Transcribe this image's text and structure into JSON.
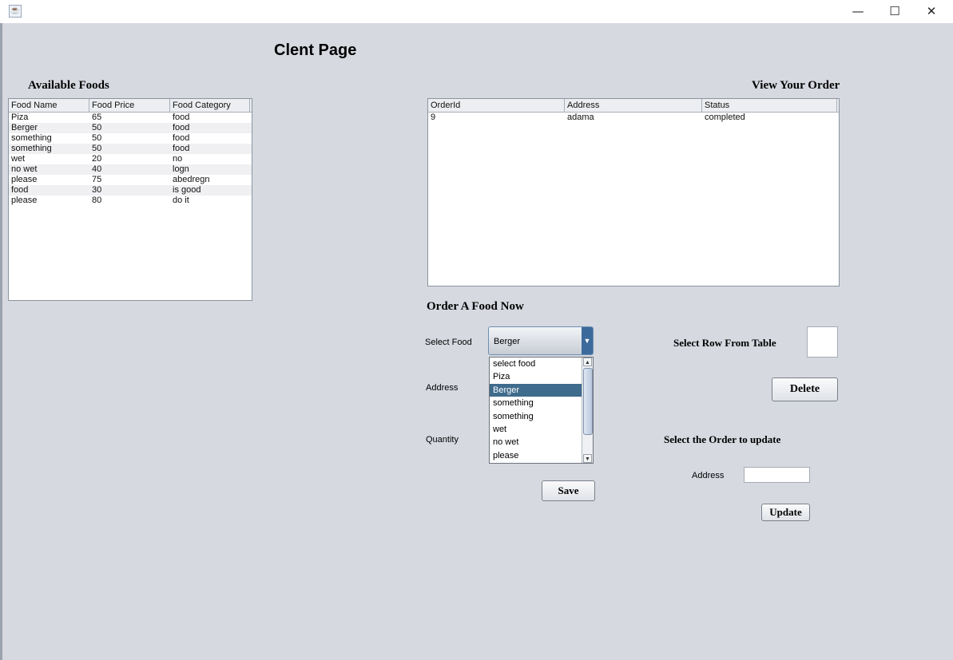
{
  "window": {
    "minimize": "—",
    "maximize": "☐",
    "close": "✕",
    "app_icon": "java-cup-icon"
  },
  "page_title": "Clent Page",
  "foods": {
    "heading": "Available Foods",
    "columns": [
      "Food Name",
      "Food Price",
      "Food Category"
    ],
    "rows": [
      [
        "Piza",
        "65",
        "food"
      ],
      [
        "Berger",
        "50",
        "food"
      ],
      [
        "something",
        "50",
        "food"
      ],
      [
        "something",
        "50",
        "food"
      ],
      [
        "wet",
        "20",
        "no"
      ],
      [
        "no wet",
        "40",
        "logn"
      ],
      [
        "please",
        "75",
        "abedregn"
      ],
      [
        "food",
        "30",
        "is good"
      ],
      [
        "please",
        "80",
        "do it"
      ]
    ]
  },
  "orders": {
    "heading": "View Your Order",
    "columns": [
      "OrderId",
      "Address",
      "Status"
    ],
    "rows": [
      [
        "9",
        "adama",
        "completed"
      ]
    ]
  },
  "order_form": {
    "heading": "Order A Food Now",
    "select_food_label": "Select Food",
    "selected_food": "Berger",
    "address_label": "Address",
    "quantity_label": "Quantity",
    "dropdown_options": [
      "select food",
      "Piza",
      "Berger",
      "something",
      "something",
      "wet",
      "no wet",
      "please"
    ],
    "selected_index": 2,
    "save_label": "Save"
  },
  "delete_panel": {
    "label": "Select Row From Table",
    "delete_label": "Delete"
  },
  "update_panel": {
    "label": "Select the Order to update",
    "address_label": "Address",
    "update_label": "Update"
  }
}
